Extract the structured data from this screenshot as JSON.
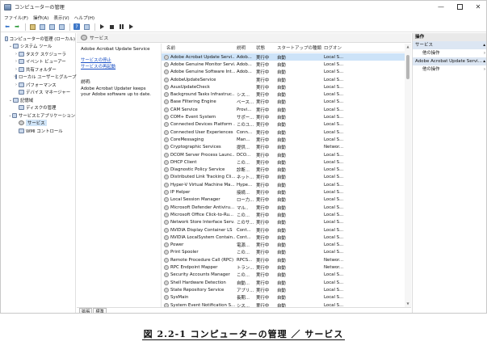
{
  "window": {
    "title": "コンピューターの管理"
  },
  "window_controls": {
    "min": "—",
    "close": "✕"
  },
  "menu": [
    "ファイル(F)",
    "操作(A)",
    "表示(V)",
    "ヘルプ(H)"
  ],
  "tree": [
    {
      "label": "コンピューターの管理 (ローカル)",
      "indent": 0,
      "exp": "",
      "icon": "computer-icon"
    },
    {
      "label": "システム ツール",
      "indent": 1,
      "exp": "⌄",
      "icon": "tools-icon"
    },
    {
      "label": "タスク スケジューラ",
      "indent": 2,
      "exp": "›",
      "icon": "clock-icon"
    },
    {
      "label": "イベント ビューアー",
      "indent": 2,
      "exp": "›",
      "icon": "event-viewer-icon"
    },
    {
      "label": "共有フォルダー",
      "indent": 2,
      "exp": "›",
      "icon": "folder-icon"
    },
    {
      "label": "ローカル ユーザーとグループ",
      "indent": 2,
      "exp": "›",
      "icon": "users-icon"
    },
    {
      "label": "パフォーマンス",
      "indent": 2,
      "exp": "›",
      "icon": "performance-icon"
    },
    {
      "label": "デバイス マネージャー",
      "indent": 2,
      "exp": "",
      "icon": "device-manager-icon"
    },
    {
      "label": "記憶域",
      "indent": 1,
      "exp": "⌄",
      "icon": "storage-icon"
    },
    {
      "label": "ディスクの管理",
      "indent": 2,
      "exp": "",
      "icon": "disk-icon"
    },
    {
      "label": "サービスとアプリケーション",
      "indent": 1,
      "exp": "⌄",
      "icon": "services-apps-icon"
    },
    {
      "label": "サービス",
      "indent": 2,
      "exp": "",
      "icon": "gear-icon",
      "selected": true
    },
    {
      "label": "WMI コントロール",
      "indent": 2,
      "exp": "",
      "icon": "wmi-icon"
    }
  ],
  "services_header": {
    "title": "サービス"
  },
  "description_pane": {
    "service_name": "Adobe Acrobat Update Service",
    "stop_link": "サービスの停止",
    "restart_link": "サービスの再起動",
    "desc_label": "説明:",
    "desc_text": "Adobe Acrobat Updater keeps your Adobe software up to date."
  },
  "columns": {
    "name": "名前",
    "desc": "説明",
    "state": "状態",
    "startup": "スタートアップの種類",
    "logon": "ログオン"
  },
  "services": [
    {
      "name": "Adobe Acrobat Update Servi...",
      "desc": "Adob...",
      "state": "実行中",
      "startup": "自動",
      "logon": "Local S...",
      "selected": true
    },
    {
      "name": "Adobe Genuine Monitor Servi...",
      "desc": "Adob...",
      "state": "実行中",
      "startup": "自動",
      "logon": "Local S..."
    },
    {
      "name": "Adobe Genuine Software Int...",
      "desc": "Adob...",
      "state": "実行中",
      "startup": "自動",
      "logon": "Local S..."
    },
    {
      "name": "AdobeUpdateService",
      "desc": "",
      "state": "実行中",
      "startup": "自動",
      "logon": "Local S..."
    },
    {
      "name": "AsusUpdateCheck",
      "desc": "",
      "state": "実行中",
      "startup": "自動",
      "logon": "Local S..."
    },
    {
      "name": "Background Tasks Infrastruc...",
      "desc": "シス...",
      "state": "実行中",
      "startup": "自動",
      "logon": "Local S..."
    },
    {
      "name": "Base Filtering Engine",
      "desc": "ベース...",
      "state": "実行中",
      "startup": "自動",
      "logon": "Local S..."
    },
    {
      "name": "CAM Service",
      "desc": "Provi...",
      "state": "実行中",
      "startup": "自動",
      "logon": "Local S..."
    },
    {
      "name": "COM+ Event System",
      "desc": "サポー...",
      "state": "実行中",
      "startup": "自動",
      "logon": "Local S..."
    },
    {
      "name": "Connected Devices Platform ...",
      "desc": "このユ...",
      "state": "実行中",
      "startup": "自動",
      "logon": "Local S..."
    },
    {
      "name": "Connected User Experiences ...",
      "desc": "Conn...",
      "state": "実行中",
      "startup": "自動",
      "logon": "Local S..."
    },
    {
      "name": "CoreMessaging",
      "desc": "Man...",
      "state": "実行中",
      "startup": "自動",
      "logon": "Local S..."
    },
    {
      "name": "Cryptographic Services",
      "desc": "提供...",
      "state": "実行中",
      "startup": "自動",
      "logon": "Networ..."
    },
    {
      "name": "DCOM Server Process Launc...",
      "desc": "DCO...",
      "state": "実行中",
      "startup": "自動",
      "logon": "Local S..."
    },
    {
      "name": "DHCP Client",
      "desc": "この...",
      "state": "実行中",
      "startup": "自動",
      "logon": "Local S..."
    },
    {
      "name": "Diagnostic Policy Service",
      "desc": "診断...",
      "state": "実行中",
      "startup": "自動",
      "logon": "Local S..."
    },
    {
      "name": "Distributed Link Tracking Cli...",
      "desc": "ネット...",
      "state": "実行中",
      "startup": "自動",
      "logon": "Local S..."
    },
    {
      "name": "Hyper-V Virtual Machine Ma...",
      "desc": "Hype...",
      "state": "実行中",
      "startup": "自動",
      "logon": "Local S..."
    },
    {
      "name": "IP Helper",
      "desc": "接続...",
      "state": "実行中",
      "startup": "自動",
      "logon": "Local S..."
    },
    {
      "name": "Local Session Manager",
      "desc": "ロー力...",
      "state": "実行中",
      "startup": "自動",
      "logon": "Local S..."
    },
    {
      "name": "Microsoft Defender Antiviru...",
      "desc": "マル..",
      "state": "実行中",
      "startup": "自動",
      "logon": "Local S..."
    },
    {
      "name": "Microsoft Office Click-to-Ru...",
      "desc": "この...",
      "state": "実行中",
      "startup": "自動",
      "logon": "Local S..."
    },
    {
      "name": "Network Store Interface Serv...",
      "desc": "このサ...",
      "state": "実行中",
      "startup": "自動",
      "logon": "Local S..."
    },
    {
      "name": "NVIDIA Display Container LS",
      "desc": "Cont...",
      "state": "実行中",
      "startup": "自動",
      "logon": "Local S..."
    },
    {
      "name": "NVIDIA LocalSystem Contain...",
      "desc": "Cont...",
      "state": "実行中",
      "startup": "自動",
      "logon": "Local S..."
    },
    {
      "name": "Power",
      "desc": "電源...",
      "state": "実行中",
      "startup": "自動",
      "logon": "Local S..."
    },
    {
      "name": "Print Spooler",
      "desc": "この...",
      "state": "実行中",
      "startup": "自動",
      "logon": "Local S..."
    },
    {
      "name": "Remote Procedure Call (RPC)",
      "desc": "RPCS...",
      "state": "実行中",
      "startup": "自動",
      "logon": "Networ..."
    },
    {
      "name": "RPC Endpoint Mapper",
      "desc": "トラン...",
      "state": "実行中",
      "startup": "自動",
      "logon": "Networ..."
    },
    {
      "name": "Security Accounts Manager",
      "desc": "この...",
      "state": "実行中",
      "startup": "自動",
      "logon": "Local S..."
    },
    {
      "name": "Shell Hardware Detection",
      "desc": "自動...",
      "state": "実行中",
      "startup": "自動",
      "logon": "Local S..."
    },
    {
      "name": "State Repository Service",
      "desc": "アプリ...",
      "state": "実行中",
      "startup": "自動",
      "logon": "Local S..."
    },
    {
      "name": "SysMain",
      "desc": "長期...",
      "state": "実行中",
      "startup": "自動",
      "logon": "Local S..."
    },
    {
      "name": "System Event Notification S...",
      "desc": "シス...",
      "state": "実行中",
      "startup": "自動",
      "logon": "Local S..."
    }
  ],
  "tabs": [
    "拡張",
    "標準"
  ],
  "operations": {
    "header": "操作",
    "section1": "サービス",
    "item1": "他の操作",
    "section2": "Adobe Acrobat Update Servi...",
    "item2": "他の操作",
    "expand_arrow": "▴",
    "more_arrow": "›"
  },
  "caption": "図 2.2-1 コンピューターの管理 ／ サービス"
}
